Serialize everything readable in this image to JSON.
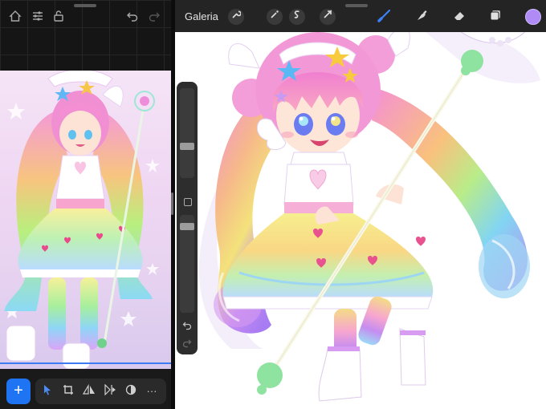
{
  "colors": {
    "accent": "#1e74f2",
    "brush_active": "#3b82f6",
    "current_color": "#b08bf5",
    "toolbar_bg": "#242424",
    "left_bg": "#151515"
  },
  "left_app": {
    "top_icons": [
      "home-icon",
      "sliders-icon",
      "unlock-icon",
      "undo-icon",
      "redo-icon"
    ],
    "add_label": "+",
    "toolbar_icons": [
      "select-icon",
      "crop-icon",
      "flip-horizontal-icon",
      "flip-vertical-icon",
      "adjust-icon",
      "more-icon"
    ],
    "more_label": "···"
  },
  "procreate": {
    "gallery_label": "Galeria",
    "tools": [
      "wrench-icon",
      "magic-wand-icon",
      "selection-icon",
      "transform-icon"
    ],
    "right_tools": [
      "brush-icon",
      "smudge-icon",
      "eraser-icon",
      "layers-icon"
    ],
    "side_icons": [
      "undo-icon",
      "redo-icon"
    ]
  }
}
